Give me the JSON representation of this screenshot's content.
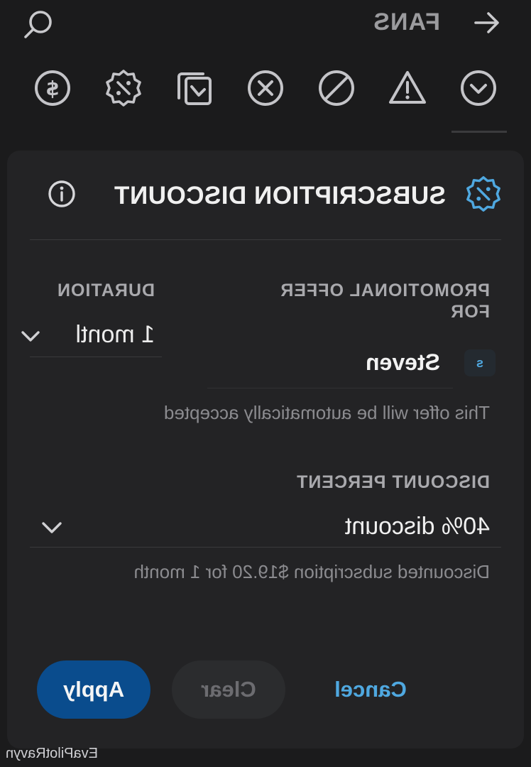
{
  "topbar": {
    "title": "FANS",
    "back_icon": "arrow-left-icon",
    "search_icon": "search-icon"
  },
  "icon_row": [
    "chevron-down-circle-icon",
    "warning-icon",
    "block-icon",
    "cancel-circle-icon",
    "copy-check-icon",
    "discount-badge-icon",
    "dollar-circle-icon"
  ],
  "card": {
    "title": "SUBSCRIPTION DISCOUNT",
    "promo_label": "PROMOTIONAL OFFER FOR",
    "recipient_initial": "s",
    "recipient_name": "Steven",
    "duration_label": "DURATION",
    "duration_value": "1 montl",
    "auto_note": "This offer will be automatically accepted",
    "discount_label": "DISCOUNT PERCENT",
    "discount_value": "40% discount",
    "calc_note": "Discounted subscription $19.20 for 1 month",
    "buttons": {
      "cancel": "Cancel",
      "clear": "Clear",
      "apply": "Apply"
    }
  },
  "watermark": "EvaPilotRavyn",
  "colors": {
    "accent": "#4fa8e0",
    "apply": "#0a4c8d",
    "bg": "#1b1b1c",
    "card": "#232325"
  }
}
